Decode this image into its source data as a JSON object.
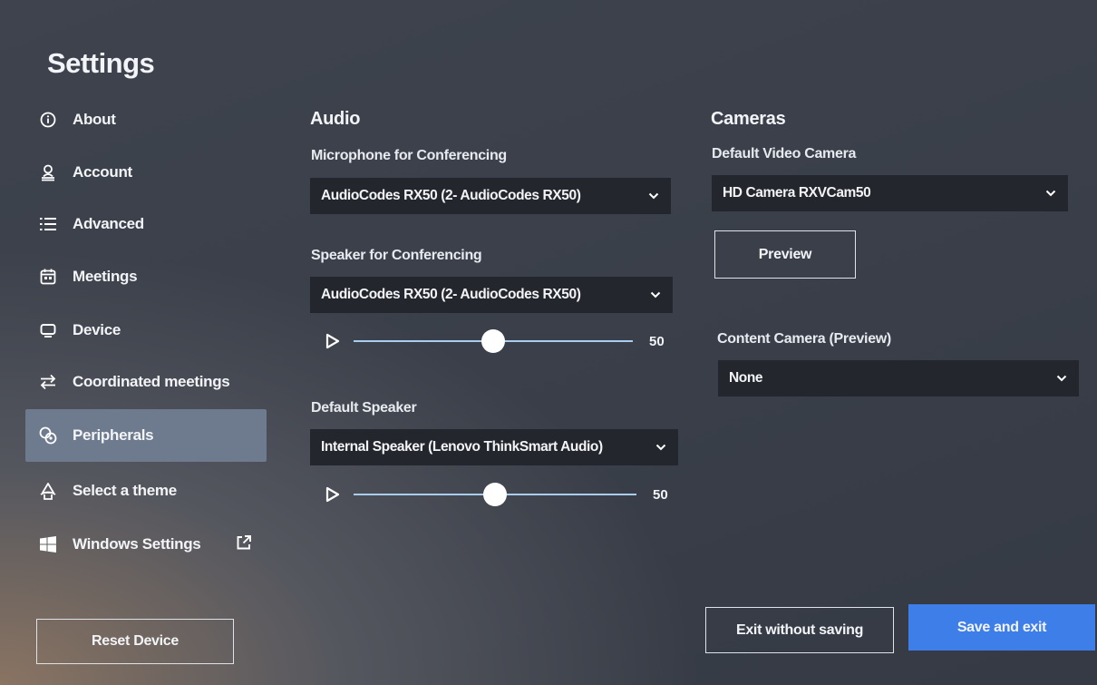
{
  "title": "Settings",
  "nav": [
    {
      "label": "About",
      "icon": "info-icon"
    },
    {
      "label": "Account",
      "icon": "person-icon"
    },
    {
      "label": "Advanced",
      "icon": "list-icon"
    },
    {
      "label": "Meetings",
      "icon": "calendar-icon"
    },
    {
      "label": "Device",
      "icon": "monitor-icon"
    },
    {
      "label": "Coordinated meetings",
      "icon": "arrows-swap-icon"
    },
    {
      "label": "Peripherals",
      "icon": "peripherals-icon",
      "active": true
    },
    {
      "label": "Select a theme",
      "icon": "theme-icon"
    },
    {
      "label": "Windows Settings",
      "icon": "windows-icon"
    }
  ],
  "reset_label": "Reset Device",
  "audio": {
    "heading": "Audio",
    "mic_label": "Microphone for Conferencing",
    "mic_value": "AudioCodes RX50 (2- AudioCodes RX50)",
    "speaker_label": "Speaker for Conferencing",
    "speaker_value": "AudioCodes RX50 (2- AudioCodes RX50)",
    "speaker_volume": 50,
    "speaker_volume_text": "50",
    "default_speaker_label": "Default Speaker",
    "default_speaker_value": "Internal Speaker (Lenovo ThinkSmart Audio)",
    "default_speaker_volume": 50,
    "default_speaker_volume_text": "50"
  },
  "cameras": {
    "heading": "Cameras",
    "default_label": "Default Video Camera",
    "default_value": "HD Camera RXVCam50",
    "preview_label": "Preview",
    "content_label": "Content Camera (Preview)",
    "content_value": "None"
  },
  "footer": {
    "exit_label": "Exit without saving",
    "save_label": "Save and exit"
  },
  "colors": {
    "accent": "#3d7ee8",
    "active_nav": "#6e7a8d",
    "select_bg": "#23262c",
    "slider_track": "#a9cdee"
  }
}
